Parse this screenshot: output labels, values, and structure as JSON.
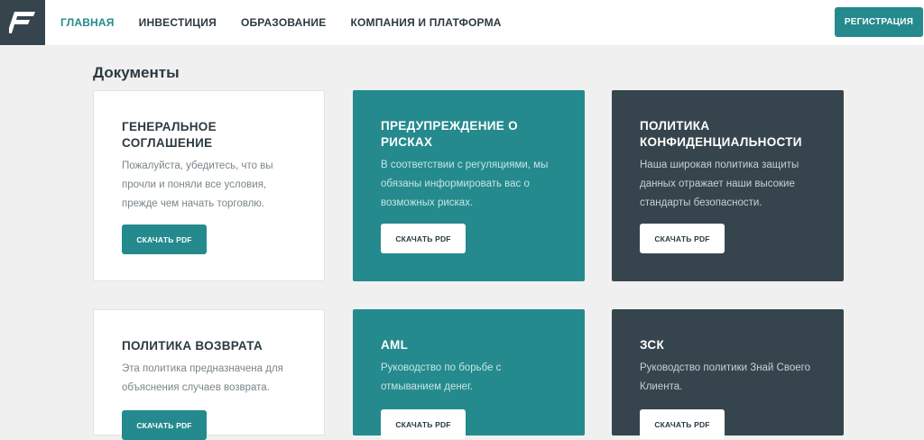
{
  "header": {
    "logo_letter": "F",
    "nav": [
      "ГЛАВНАЯ",
      "ИНВЕСТИЦИЯ",
      "ОБРАЗОВАНИЕ",
      "КОМПАНИЯ И ПЛАТФОРМА"
    ],
    "register_label": "РЕГИСТРАЦИЯ"
  },
  "colors": {
    "accent": "#248a8d",
    "dark": "#36454d",
    "background": "#f0f0f0"
  },
  "section": {
    "title": "Документы"
  },
  "cards": [
    {
      "title_lines": [
        "ГЕНЕРАЛЬНОЕ",
        "СОГЛАШЕНИЕ"
      ],
      "desc_lines": [
        "Пожалуйста, убедитесь, что вы",
        "прочли и поняли все условия,",
        "прежде чем начать торговлю."
      ],
      "button": "СКАЧАТЬ PDF"
    },
    {
      "title_lines": [
        "ПРЕДУПРЕЖДЕНИЕ О",
        "РИСКАХ"
      ],
      "desc_lines": [
        "В соответствии с регуляциями, мы",
        "обязаны информировать вас о",
        "возможных рисках."
      ],
      "button": "СКАЧАТЬ PDF"
    },
    {
      "title_lines": [
        "ПОЛИТИКА",
        "КОНФИДЕНЦИАЛЬНОСТИ"
      ],
      "desc_lines": [
        "Наша широкая политика защиты",
        "данных отражает наши высокие",
        "стандарты безопасности."
      ],
      "button": "СКАЧАТЬ PDF"
    },
    {
      "title_lines": [
        "ПОЛИТИКА ВОЗВРАТА"
      ],
      "desc_lines": [
        "Эта политика предназначена для",
        "объяснения случаев возврата."
      ],
      "button": "СКАЧАТЬ PDF"
    },
    {
      "title_lines": [
        "AML"
      ],
      "desc_lines": [
        "Руководство по борьбе с",
        "отмыванием денег."
      ],
      "button": "СКАЧАТЬ PDF"
    },
    {
      "title_lines": [
        "ЗСК"
      ],
      "desc_lines": [
        "Руководство политики Знай Своего",
        "Клиента."
      ],
      "button": "СКАЧАТЬ PDF"
    }
  ]
}
